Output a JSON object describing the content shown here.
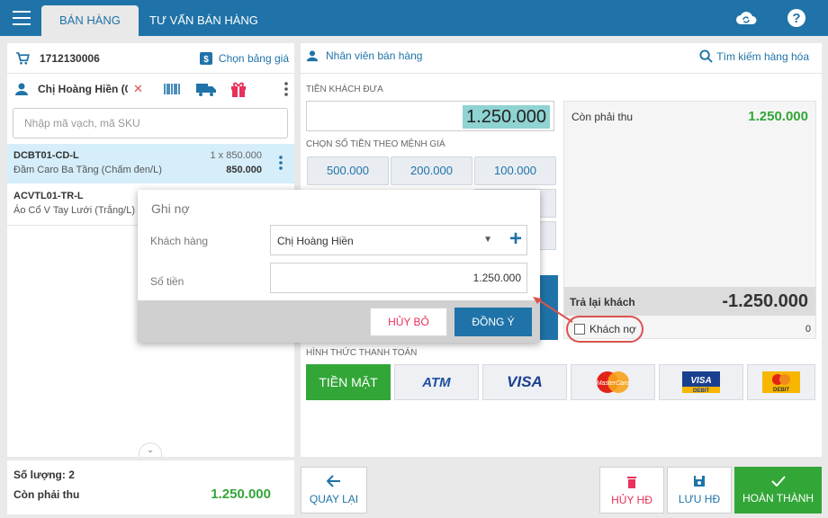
{
  "header": {
    "tabs": [
      {
        "label": "BÁN HÀNG"
      },
      {
        "label": "TƯ VẤN BÁN HÀNG"
      }
    ]
  },
  "order": {
    "id": "1712130006",
    "price_list_label": "Chọn bảng giá",
    "customer": "Chị Hoàng Hiền (0",
    "search_placeholder": "Nhập mã vạch, mã SKU",
    "items": [
      {
        "sku": "DCBT01-CD-L",
        "name": "Đầm Caro Ba Tầng (Chấm đen/L)",
        "qty_price": "1 x 850.000",
        "total": "850.000"
      },
      {
        "sku": "ACVTL01-TR-L",
        "name": "Áo Cổ V Tay Lưới (Trắng/L)"
      }
    ],
    "quantity_label": "Số lượng: 2",
    "due_label": "Còn phải thu",
    "due_value": "1.250.000"
  },
  "payment": {
    "staff_label": "Nhân viên bán hàng",
    "search_label": "Tìm kiếm hàng hóa",
    "given_label": "TIỀN KHÁCH ĐƯA",
    "given_value": "1.250.000",
    "denom_label": "CHỌN SỐ TIỀN THEO MỆNH GIÁ",
    "denominations": [
      "500.000",
      "200.000",
      "100.000"
    ],
    "remaining_label": "Còn phải thu",
    "remaining_value": "1.250.000",
    "change_label": "Trả lại khách",
    "change_value": "-1.250.000",
    "debt_label": "Khách nợ",
    "debt_value": "0",
    "method_label": "HÌNH THỨC THANH TOÁN",
    "methods": {
      "cash": "TIỀN MẶT",
      "atm": "ATM",
      "visa": "VISA",
      "mastercard": "MasterCard",
      "visa_debit_top": "VISA",
      "visa_debit_bottom": "DEBIT",
      "debit": "DEBIT"
    }
  },
  "dialog": {
    "title": "Ghi nợ",
    "customer_label": "Khách hàng",
    "customer_value": "Chị Hoàng Hiền",
    "amount_label": "Số tiền",
    "amount_value": "1.250.000",
    "cancel": "HỦY BỎ",
    "confirm": "ĐỒNG Ý"
  },
  "actions": {
    "back": "QUAY LẠI",
    "cancel_invoice": "HỦY HĐ",
    "save_invoice": "LƯU HĐ",
    "complete": "HOÀN THÀNH"
  },
  "colors": {
    "primary": "#1f73a8",
    "green": "#33a638",
    "red": "#d9534f",
    "highlight": "#8fd3d3"
  }
}
